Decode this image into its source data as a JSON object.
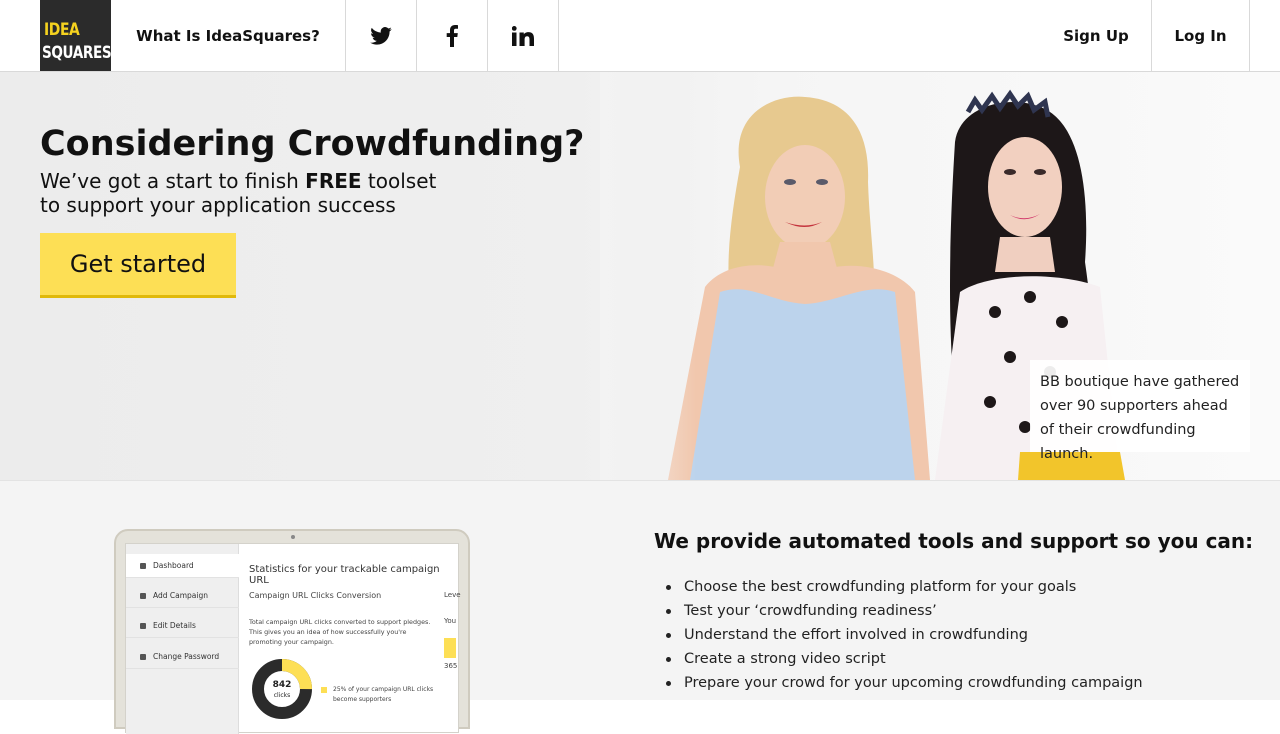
{
  "header": {
    "logo_line1": "IDEA",
    "logo_line2": "SQUARES",
    "what_is": "What Is IdeaSquares?",
    "social": [
      "twitter-icon",
      "facebook-icon",
      "linkedin-icon"
    ],
    "sign_up": "Sign Up",
    "log_in": "Log In"
  },
  "hero": {
    "title": "Considering Crowdfunding?",
    "sub_pre": "We’ve got a start to finish ",
    "sub_bold": "FREE",
    "sub_post": " toolset",
    "sub_line2": "to support your application success",
    "cta": "Get started",
    "caption": "BB boutique have gathered over 90 supporters ahead of their crowdfunding launch."
  },
  "dashboard": {
    "nav": [
      "Dashboard",
      "Add Campaign",
      "Edit Details",
      "Change Password"
    ],
    "title": "Statistics for your trackable campaign URL",
    "subtitle": "Campaign URL Clicks Conversion",
    "description": "Total campaign URL clicks converted to support pledges. This gives you an idea of how successfully you're promoting your campaign.",
    "level": "Leve",
    "you": "You",
    "side_value": "365",
    "clicks_value": "842",
    "clicks_label": "clicks",
    "legend": "25% of your campaign URL clicks become supporters",
    "donut_fraction": 0.25
  },
  "lower": {
    "title": "We provide automated tools and support so you can:",
    "items": [
      "Choose the best crowdfunding platform for your goals",
      "Test your ‘crowdfunding readiness’",
      "Understand the effort involved in crowdfunding",
      "Create a strong video script",
      "Prepare your crowd for your upcoming crowdfunding campaign"
    ]
  },
  "colors": {
    "accent_yellow": "#fddf55",
    "logo_bg": "#2b2b2b"
  }
}
